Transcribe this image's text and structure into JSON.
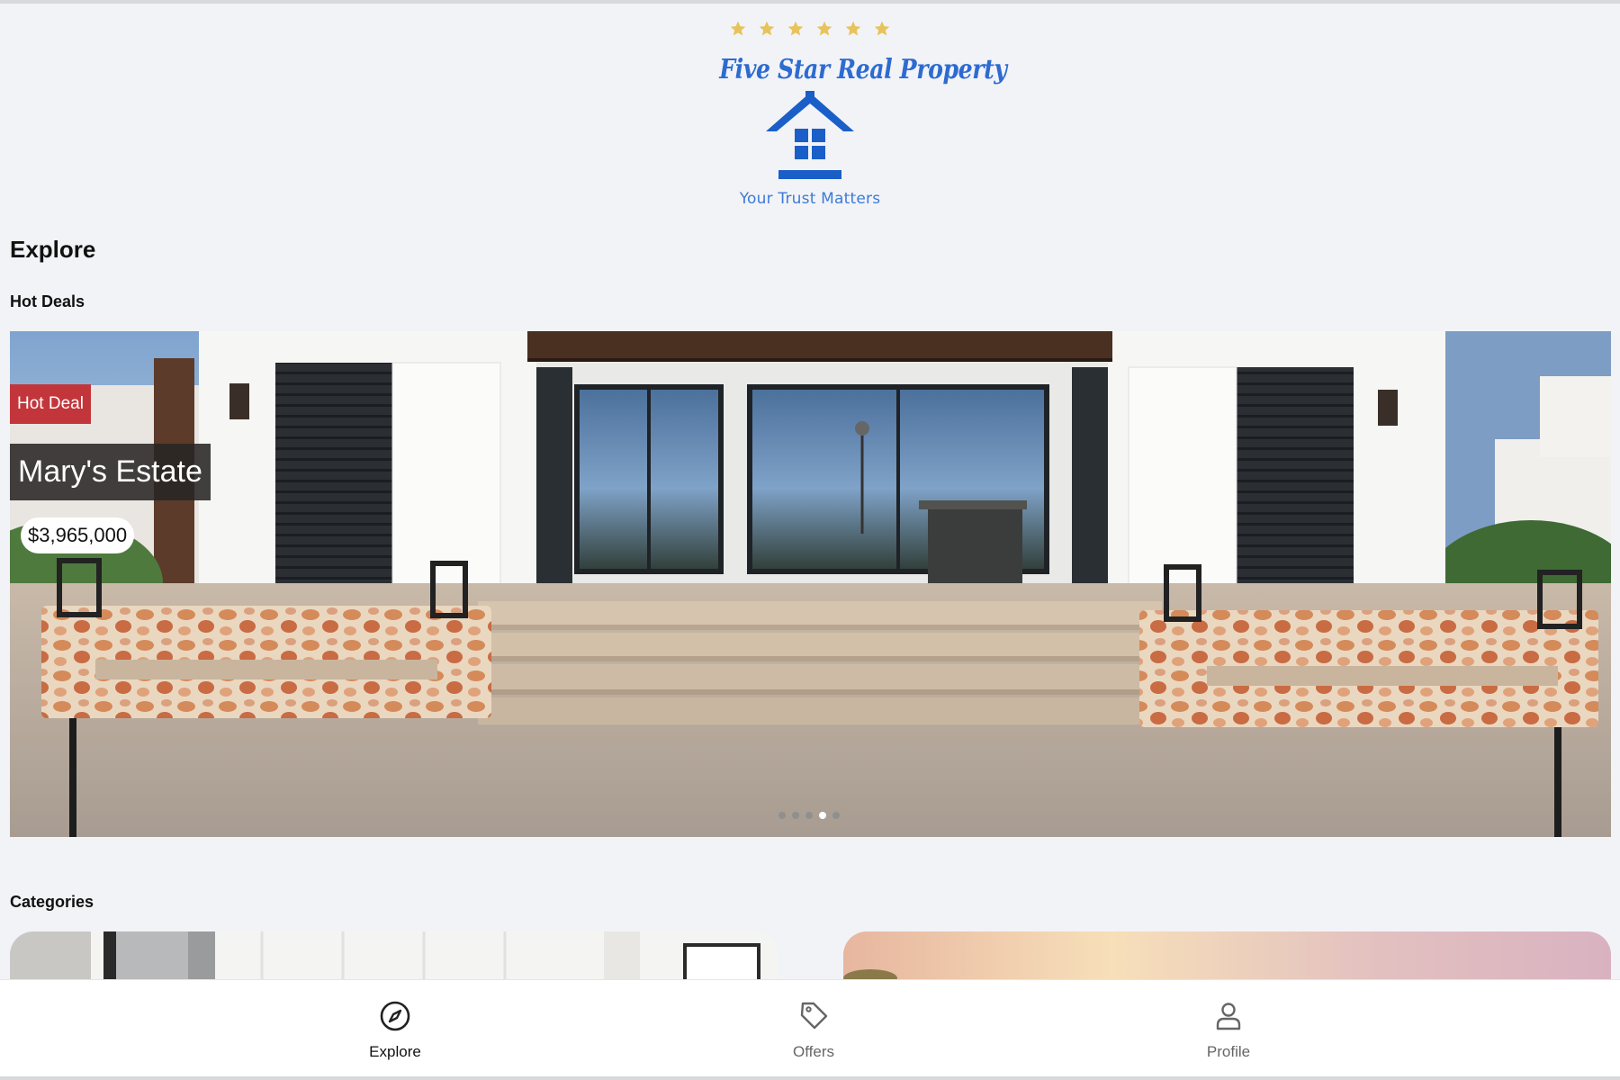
{
  "brand": {
    "name": "Five Star Real Property",
    "tagline": "Your Trust Matters",
    "star_count": 6,
    "star_color": "#e7c35a",
    "logo_color": "#1a5fc8",
    "icon": "house-logo-icon"
  },
  "explore": {
    "title": "Explore",
    "hot_deals_title": "Hot Deals",
    "categories_title": "Categories"
  },
  "hero": {
    "badge": "Hot Deal",
    "badge_color": "#c2363b",
    "property_name": "Mary's Estate",
    "price": "$3,965,000",
    "slide_count": 5,
    "active_slide": 4
  },
  "nav": {
    "items": [
      {
        "label": "Explore",
        "icon": "compass-icon",
        "active": true
      },
      {
        "label": "Offers",
        "icon": "tag-icon",
        "active": false
      },
      {
        "label": "Profile",
        "icon": "user-icon",
        "active": false
      }
    ]
  }
}
